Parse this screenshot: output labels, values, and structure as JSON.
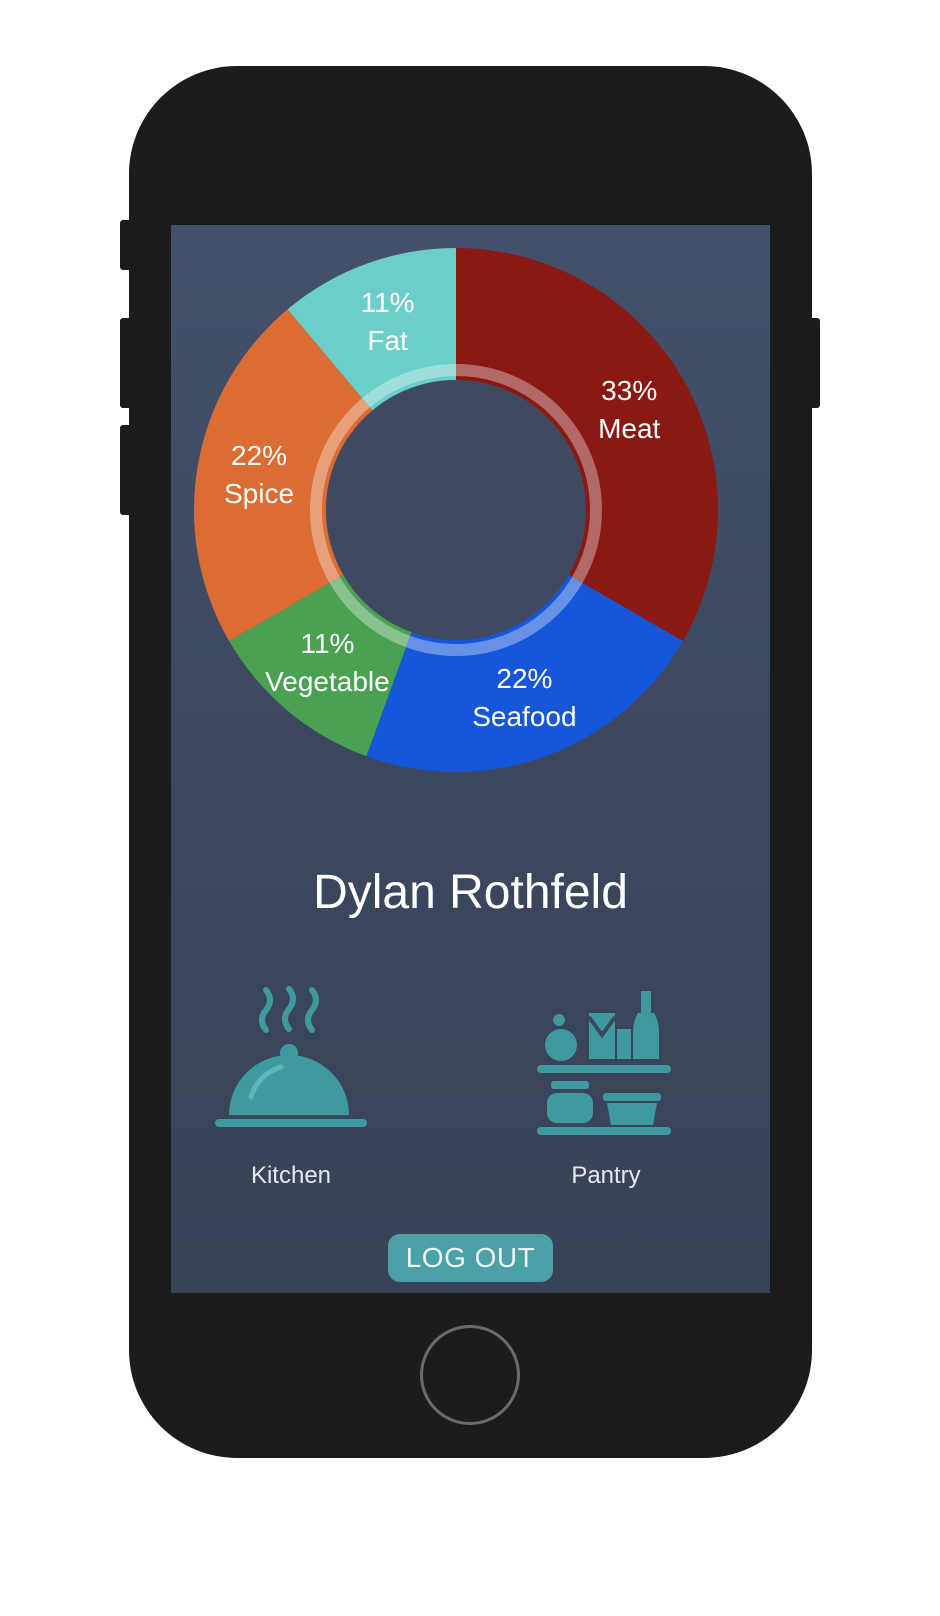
{
  "chart_data": {
    "type": "pie",
    "slices": [
      {
        "label": "Meat",
        "value": 33,
        "percent_text": "33%",
        "color": "#8a1914"
      },
      {
        "label": "Seafood",
        "value": 22,
        "percent_text": "22%",
        "color": "#1656d9"
      },
      {
        "label": "Vegetable",
        "value": 11,
        "percent_text": "11%",
        "color": "#4aa152"
      },
      {
        "label": "Spice",
        "value": 22,
        "percent_text": "22%",
        "color": "#db6d34"
      },
      {
        "label": "Fat",
        "value": 11,
        "percent_text": "11%",
        "color": "#6bcec9"
      }
    ]
  },
  "profile": {
    "name": "Dylan Rothfeld"
  },
  "nav": {
    "kitchen": {
      "label": "Kitchen",
      "icon": "cloche-icon"
    },
    "pantry": {
      "label": "Pantry",
      "icon": "pantry-shelf-icon"
    }
  },
  "logout": {
    "label": "LOG OUT"
  },
  "colors": {
    "accent": "#4ca1a6",
    "screen_bg": "#3e4a60",
    "text": "#ffffff"
  }
}
